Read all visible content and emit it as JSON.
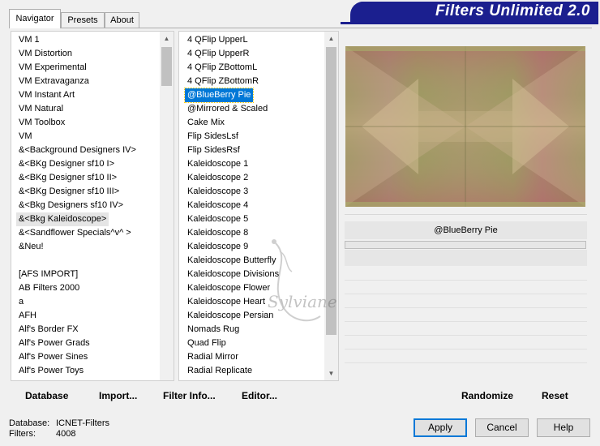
{
  "app": {
    "title": "Filters Unlimited 2.0"
  },
  "tabs": [
    {
      "label": "Navigator",
      "active": true
    },
    {
      "label": "Presets",
      "active": false
    },
    {
      "label": "About",
      "active": false
    }
  ],
  "categories": [
    "VM 1",
    "VM Distortion",
    "VM Experimental",
    "VM Extravaganza",
    "VM Instant Art",
    "VM Natural",
    "VM Toolbox",
    "VM",
    "&<Background Designers IV>",
    "&<BKg Designer sf10 I>",
    "&<BKg Designer sf10 II>",
    "&<BKg Designer sf10 III>",
    "&<Bkg Designers sf10 IV>",
    "&<Bkg Kaleidoscope>",
    "&<Sandflower Specials^v^ >",
    "&Neu!",
    "",
    "[AFS IMPORT]",
    "AB Filters 2000",
    "a",
    "AFH",
    "Alf's Border FX",
    "Alf's Power Grads",
    "Alf's Power Sines",
    "Alf's Power Toys"
  ],
  "selected_category": "&<Bkg Kaleidoscope>",
  "filters": [
    "4 QFlip UpperL",
    "4 QFlip UpperR",
    "4 QFlip ZBottomL",
    "4 QFlip ZBottomR",
    "@BlueBerry Pie",
    "@Mirrored & Scaled",
    "Cake Mix",
    "Flip SidesLsf",
    "Flip SidesRsf",
    "Kaleidoscope 1",
    "Kaleidoscope 2",
    "Kaleidoscope 3",
    "Kaleidoscope 4",
    "Kaleidoscope 5",
    "Kaleidoscope 8",
    "Kaleidoscope 9",
    "Kaleidoscope Butterfly",
    "Kaleidoscope Divisions",
    "Kaleidoscope Flower",
    "Kaleidoscope Heart",
    "Kaleidoscope Persian",
    "Nomads Rug",
    "Quad Flip",
    "Radial Mirror",
    "Radial Replicate"
  ],
  "selected_filter": "@BlueBerry Pie",
  "preview": {
    "filter_name": "@BlueBerry Pie"
  },
  "toolbar": {
    "database": "Database",
    "import": "Import...",
    "filter_info": "Filter Info...",
    "editor": "Editor...",
    "randomize": "Randomize",
    "reset": "Reset"
  },
  "buttons": {
    "apply": "Apply",
    "cancel": "Cancel",
    "help": "Help"
  },
  "status": {
    "database_label": "Database:",
    "database_value": "ICNET-Filters",
    "filters_label": "Filters:",
    "filters_value": "4008"
  },
  "watermark": {
    "text": "Sylviane"
  },
  "colors": {
    "banner": "#1b1f8f",
    "selection": "#0078d7"
  },
  "icons": {
    "scroll_up": "triangle-up",
    "scroll_down": "triangle-down"
  }
}
